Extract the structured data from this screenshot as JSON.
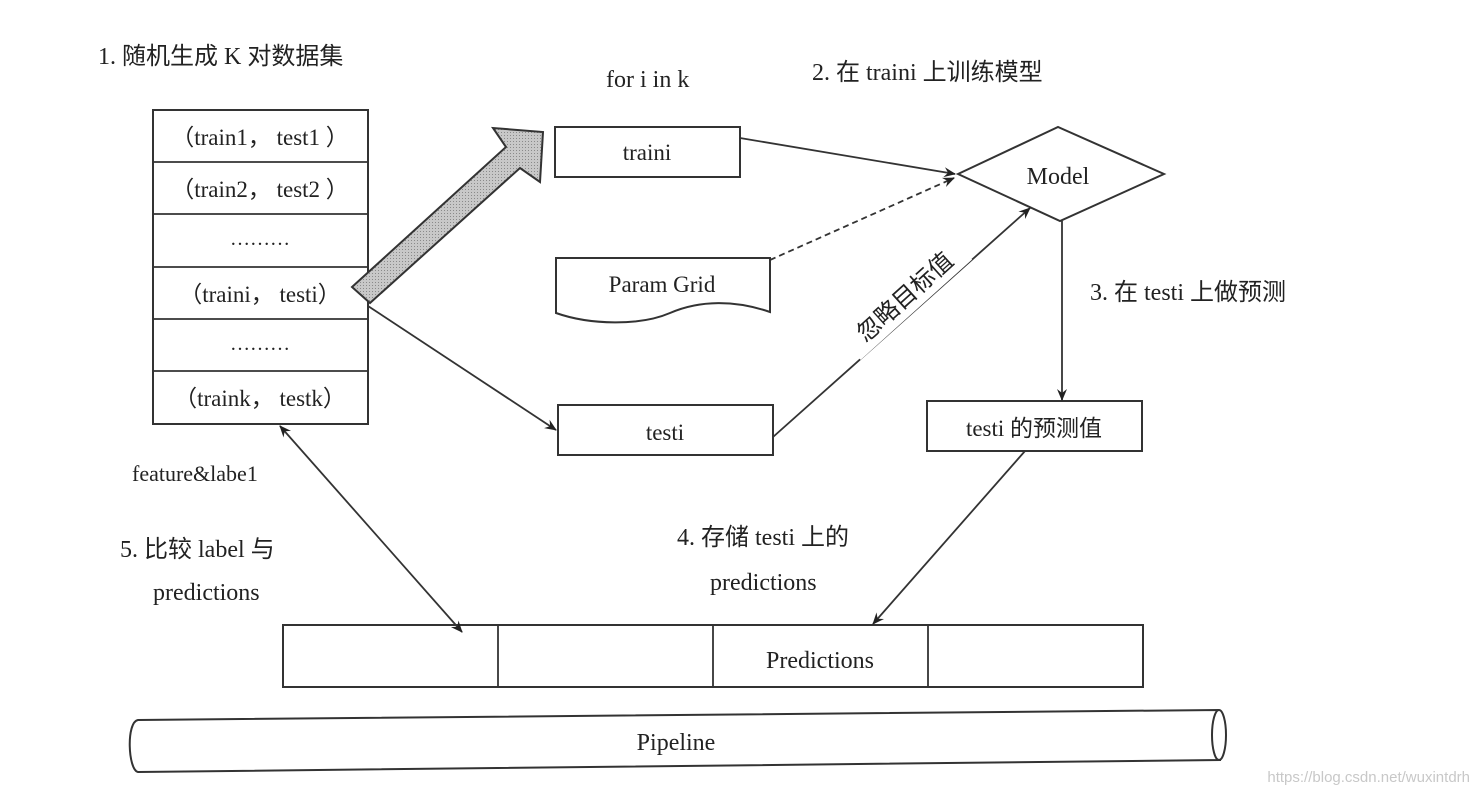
{
  "steps": {
    "step1": "1. 随机生成 K 对数据集",
    "step2": "2. 在 traini 上训练模型",
    "step3": "3. 在 testi 上做预测",
    "step4_line1": "4. 存储 testi 上的",
    "step4_line2": "predictions",
    "step5_line1": "5. 比较 label 与",
    "step5_line2": "predictions"
  },
  "loop_label": "for i in k",
  "dataset_list": [
    "（train1， test1 ）",
    "（train2， test2 ）",
    "………",
    "（traini， testi）",
    "………",
    "（traink， testk）"
  ],
  "nodes": {
    "traini": "traini",
    "param_grid": "Param Grid",
    "testi": "testi",
    "model": "Model",
    "testi_predictions": "testi 的预测值",
    "predictions": "Predictions",
    "pipeline": "Pipeline"
  },
  "edge_labels": {
    "ignore_target": "忽略目标值",
    "feature_label": "feature&labe1"
  },
  "watermark": "https://blog.csdn.net/wuxintdrh"
}
